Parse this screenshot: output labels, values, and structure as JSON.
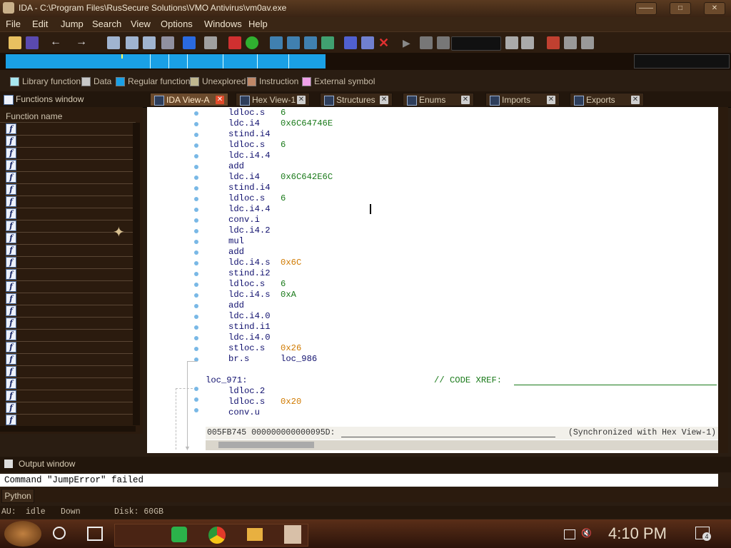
{
  "window": {
    "title": "IDA - C:\\Program Files\\RusSecure Solutions\\VMO Antivirus\\vm0av.exe",
    "controls": [
      "——",
      "□",
      "✕"
    ]
  },
  "menu": [
    "File",
    "Edit",
    "Jump",
    "Search",
    "View",
    "Options",
    "Windows",
    "Help"
  ],
  "legend": [
    {
      "label": "Library function",
      "color": "#a8e8f0"
    },
    {
      "label": "Data",
      "color": "#c8c8c8"
    },
    {
      "label": "Regular function",
      "color": "#1aa0e6"
    },
    {
      "label": "Unexplored",
      "color": "#c0b890"
    },
    {
      "label": "Instruction",
      "color": "#c08868"
    },
    {
      "label": "External symbol",
      "color": "#f0a0e8"
    }
  ],
  "functions_window": {
    "title": "Functions window",
    "column": "Function name",
    "icon_letter": "f",
    "row_count": 25
  },
  "tabs": [
    {
      "label": "IDA View-A",
      "active": true
    },
    {
      "label": "Hex View-1",
      "active": false
    },
    {
      "label": "Structures",
      "active": false
    },
    {
      "label": "Enums",
      "active": false
    },
    {
      "label": "Imports",
      "active": false
    },
    {
      "label": "Exports",
      "active": false
    }
  ],
  "code": [
    {
      "op": "ldloc.s",
      "arg": "6",
      "argType": "num"
    },
    {
      "op": "ldc.i4",
      "arg": "0x6C64746E",
      "argType": "num"
    },
    {
      "op": "stind.i4",
      "arg": "",
      "argType": ""
    },
    {
      "op": "ldloc.s",
      "arg": "6",
      "argType": "num"
    },
    {
      "op": "ldc.i4.4",
      "arg": "",
      "argType": ""
    },
    {
      "op": "add",
      "arg": "",
      "argType": ""
    },
    {
      "op": "ldc.i4",
      "arg": "0x6C642E6C",
      "argType": "num"
    },
    {
      "op": "stind.i4",
      "arg": "",
      "argType": ""
    },
    {
      "op": "ldloc.s",
      "arg": "6",
      "argType": "num"
    },
    {
      "op": "ldc.i4.4",
      "arg": "",
      "argType": ""
    },
    {
      "op": "conv.i",
      "arg": "",
      "argType": ""
    },
    {
      "op": "ldc.i4.2",
      "arg": "",
      "argType": ""
    },
    {
      "op": "mul",
      "arg": "",
      "argType": ""
    },
    {
      "op": "add",
      "arg": "",
      "argType": ""
    },
    {
      "op": "ldc.i4.s",
      "arg": "0x6C",
      "argType": "imm"
    },
    {
      "op": "stind.i2",
      "arg": "",
      "argType": ""
    },
    {
      "op": "ldloc.s",
      "arg": "6",
      "argType": "num"
    },
    {
      "op": "ldc.i4.s",
      "arg": "0xA",
      "argType": "num"
    },
    {
      "op": "add",
      "arg": "",
      "argType": ""
    },
    {
      "op": "ldc.i4.0",
      "arg": "",
      "argType": ""
    },
    {
      "op": "stind.i1",
      "arg": "",
      "argType": ""
    },
    {
      "op": "ldc.i4.0",
      "arg": "",
      "argType": ""
    },
    {
      "op": "stloc.s",
      "arg": "0x26",
      "argType": "imm"
    },
    {
      "op": "br.s",
      "arg": "loc_986",
      "argType": "ref"
    },
    {
      "op": "",
      "arg": "",
      "argType": ""
    },
    {
      "op": "loc_971:",
      "arg": "",
      "argType": "label"
    },
    {
      "op": "ldloc.2",
      "arg": "",
      "argType": ""
    },
    {
      "op": "ldloc.s",
      "arg": "0x20",
      "argType": "imm"
    },
    {
      "op": "conv.u",
      "arg": "",
      "argType": ""
    }
  ],
  "xref_comment": "// CODE XREF:",
  "status": {
    "address": "005FB745 000000000000095D:",
    "sync": "(Synchronized with Hex View-1)"
  },
  "output": {
    "title": "Output window",
    "message": "Command \"JumpError\" failed",
    "tab": "Python"
  },
  "au_bar": {
    "au": "AU:",
    "state": "idle",
    "direction": "Down",
    "disk": "Disk: 60GB"
  },
  "taskbar": {
    "time": "4:10 PM",
    "notifications": "4"
  }
}
